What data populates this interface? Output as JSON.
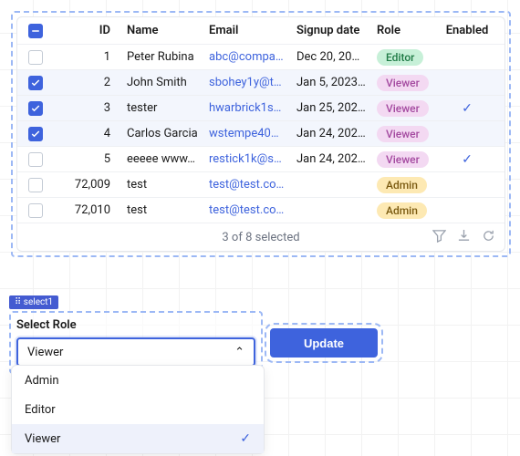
{
  "table": {
    "headers": {
      "id": "ID",
      "name": "Name",
      "email": "Email",
      "signup": "Signup date",
      "role": "Role",
      "enabled": "Enabled"
    },
    "rows": [
      {
        "selected": false,
        "id": "1",
        "name": "Peter Rubina",
        "email": "abc@compa…",
        "signup": "Dec 20, 20…",
        "role": "Editor",
        "role_class": "editor",
        "enabled": false
      },
      {
        "selected": true,
        "id": "2",
        "name": "John Smith",
        "email": "sbohey1y@t…",
        "signup": "Jan 5, 2023 …",
        "role": "Viewer",
        "role_class": "viewer",
        "enabled": false
      },
      {
        "selected": true,
        "id": "3",
        "name": "tester",
        "email": "hwarbrick1s…",
        "signup": "Jan 25, 202…",
        "role": "Viewer",
        "role_class": "viewer",
        "enabled": true
      },
      {
        "selected": true,
        "id": "4",
        "name": "Carlos Garcia",
        "email": "wstempe40…",
        "signup": "Jan 24, 202…",
        "role": "Viewer",
        "role_class": "viewer",
        "enabled": false
      },
      {
        "selected": false,
        "id": "5",
        "name": "eeeee www…",
        "email": "restick1k@s…",
        "signup": "Jan 24, 202…",
        "role": "Viewer",
        "role_class": "viewer",
        "enabled": true
      },
      {
        "selected": false,
        "id": "72,009",
        "name": "test",
        "email": "test@test.com",
        "signup": "",
        "role": "Admin",
        "role_class": "admin",
        "enabled": false
      },
      {
        "selected": false,
        "id": "72,010",
        "name": "test",
        "email": "test@test.com",
        "signup": "",
        "role": "Admin",
        "role_class": "admin",
        "enabled": false
      }
    ],
    "footer_status": "3 of 8 selected"
  },
  "select": {
    "tag": "⠿ select1",
    "label": "Select Role",
    "value": "Viewer",
    "options": [
      "Admin",
      "Editor",
      "Viewer"
    ],
    "selected_index": 2
  },
  "update_button": "Update"
}
